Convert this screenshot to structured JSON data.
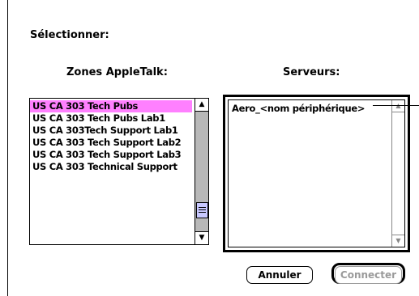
{
  "dialog": {
    "title": "Sélectionner:"
  },
  "zones": {
    "header": "Zones AppleTalk:",
    "items": [
      "US CA 303 Tech Pubs",
      "US CA 303 Tech Pubs Lab1",
      "US CA 303Tech Support Lab1",
      "US CA 303 Tech Support Lab2",
      "US CA 303 Tech Support Lab3",
      "US CA 303 Technical Support"
    ],
    "selected_index": 0,
    "selection_color": "#ff80ff",
    "scroll_up_icon": "scroll-up-arrow-icon",
    "scroll_down_icon": "scroll-down-arrow-icon"
  },
  "servers": {
    "header": "Serveurs:",
    "items": [
      "Aero_<nom périphérique>"
    ],
    "scroll_state": "disabled"
  },
  "buttons": {
    "cancel_label": "Annuler",
    "connect_label": "Connecter",
    "connect_state": "disabled",
    "default_button": "connect"
  },
  "glyphs": {
    "up": "▲",
    "down": "▼"
  }
}
